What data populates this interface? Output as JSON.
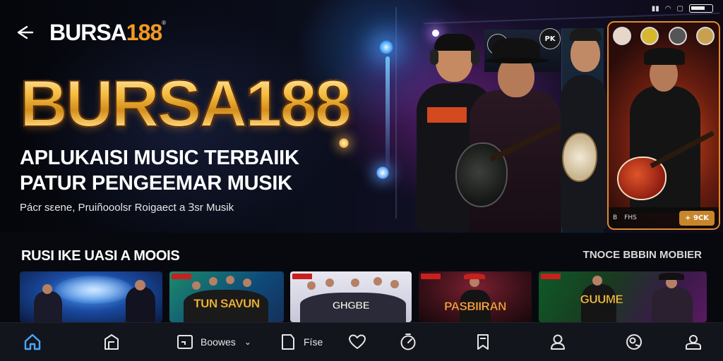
{
  "app": {
    "logo_main": "BURSA",
    "logo_num": "188",
    "logo_mark": "®"
  },
  "hero": {
    "big_title": "BURSA188",
    "tagline_1": "APLUKAISI MUSIC TERBAIIK",
    "tagline_2": "PATUR PENGEEMAR MUSIK",
    "subline": "Pácr sεene, Pruiñooolsr Roigaect a Ɜsr Musik",
    "top_right_button": "PK",
    "promo_footer_left": "B",
    "promo_footer_mid": "FHS",
    "promo_button": "+ 9CK"
  },
  "section": {
    "title": "RUSI IKE UASI A MOOIS",
    "link": "TNOCE BBBIN MOBIER"
  },
  "thumbnails": [
    {
      "title": "",
      "bg": "#1a4aa0"
    },
    {
      "title": "TUN SAVUN",
      "bg": "#1c8a6a"
    },
    {
      "title": "GHGBE",
      "bg": "#d8d8e6"
    },
    {
      "title": "PASBIIRAN",
      "bg": "#3a1018"
    },
    {
      "title": "GUUME",
      "bg": "#0e5a28"
    }
  ],
  "nav": {
    "items": [
      {
        "icon": "home-icon",
        "label": ""
      },
      {
        "icon": "library-icon",
        "label": ""
      },
      {
        "icon": "browse-icon",
        "label": "Boowes"
      },
      {
        "icon": "file-icon",
        "label": "Físe"
      },
      {
        "icon": "heart-icon",
        "label": ""
      },
      {
        "icon": "timer-icon",
        "label": ""
      },
      {
        "icon": "bookmark-icon",
        "label": ""
      },
      {
        "icon": "profile-icon",
        "label": ""
      },
      {
        "icon": "social-icon",
        "label": ""
      },
      {
        "icon": "account-icon",
        "label": ""
      }
    ],
    "active_color": "#4aa8ff"
  },
  "colors": {
    "accent_orange": "#f39a1e",
    "gold": "#f3c74b",
    "nav_bg": "#13151d"
  }
}
